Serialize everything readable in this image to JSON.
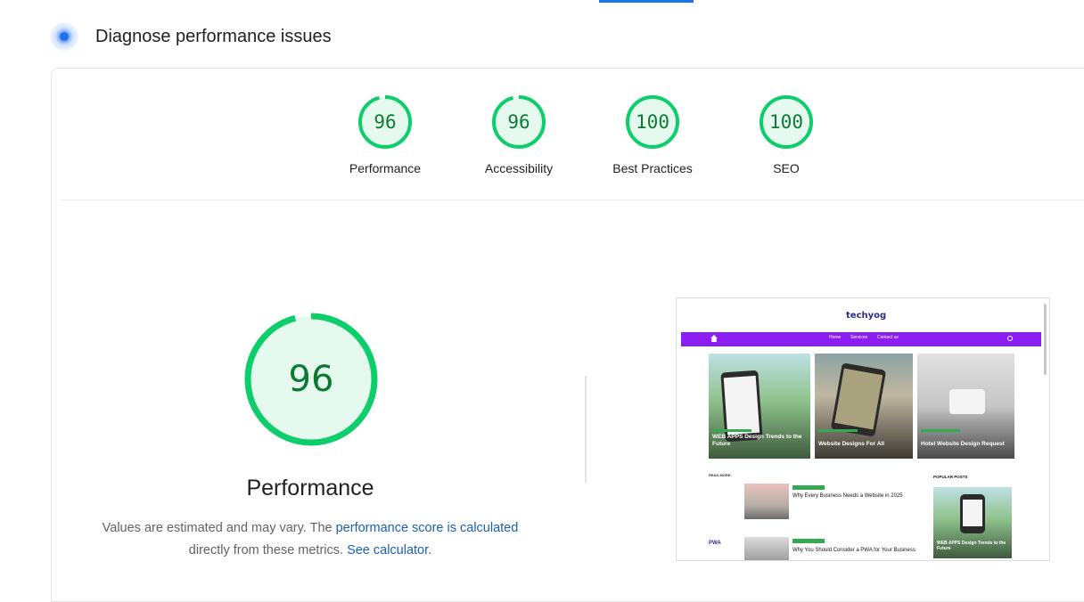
{
  "header": {
    "title": "Diagnose performance issues",
    "icon": "lighthouse-pulse-icon"
  },
  "colors": {
    "pass_green": "#0cce6b",
    "pass_text": "#0c7a33",
    "pass_fill": "#e6f9ee",
    "link": "#1a5fb4",
    "accent": "#1a73e8"
  },
  "scores": [
    {
      "label": "Performance",
      "value": "96"
    },
    {
      "label": "Accessibility",
      "value": "96"
    },
    {
      "label": "Best Practices",
      "value": "100"
    },
    {
      "label": "SEO",
      "value": "100"
    }
  ],
  "main": {
    "score": "96",
    "title": "Performance",
    "desc_prefix": "Values are estimated and may vary. The ",
    "desc_link": "performance score is calculated",
    "desc_middle": "directly from these metrics. ",
    "desc_link2": "See calculator",
    "desc_suffix": "."
  },
  "screenshot": {
    "logo": "techyog",
    "nav": [
      "Home",
      "Services",
      "Contact us"
    ],
    "tiles": [
      {
        "caption": "WEB APPS Design Trends to the Future"
      },
      {
        "caption": "Website Designs For All"
      },
      {
        "caption": "Hotel Website Design Request"
      }
    ],
    "read_more": "READ MORE:",
    "side_heading": "POPULAR POSTS",
    "posts": [
      "Why Every Business Needs a Website in 2025",
      "Why You Should Consider a PWA for Your Business"
    ],
    "side_caption": "WEB APPS Design Trends to the Future",
    "pwa_label": "PWA"
  }
}
